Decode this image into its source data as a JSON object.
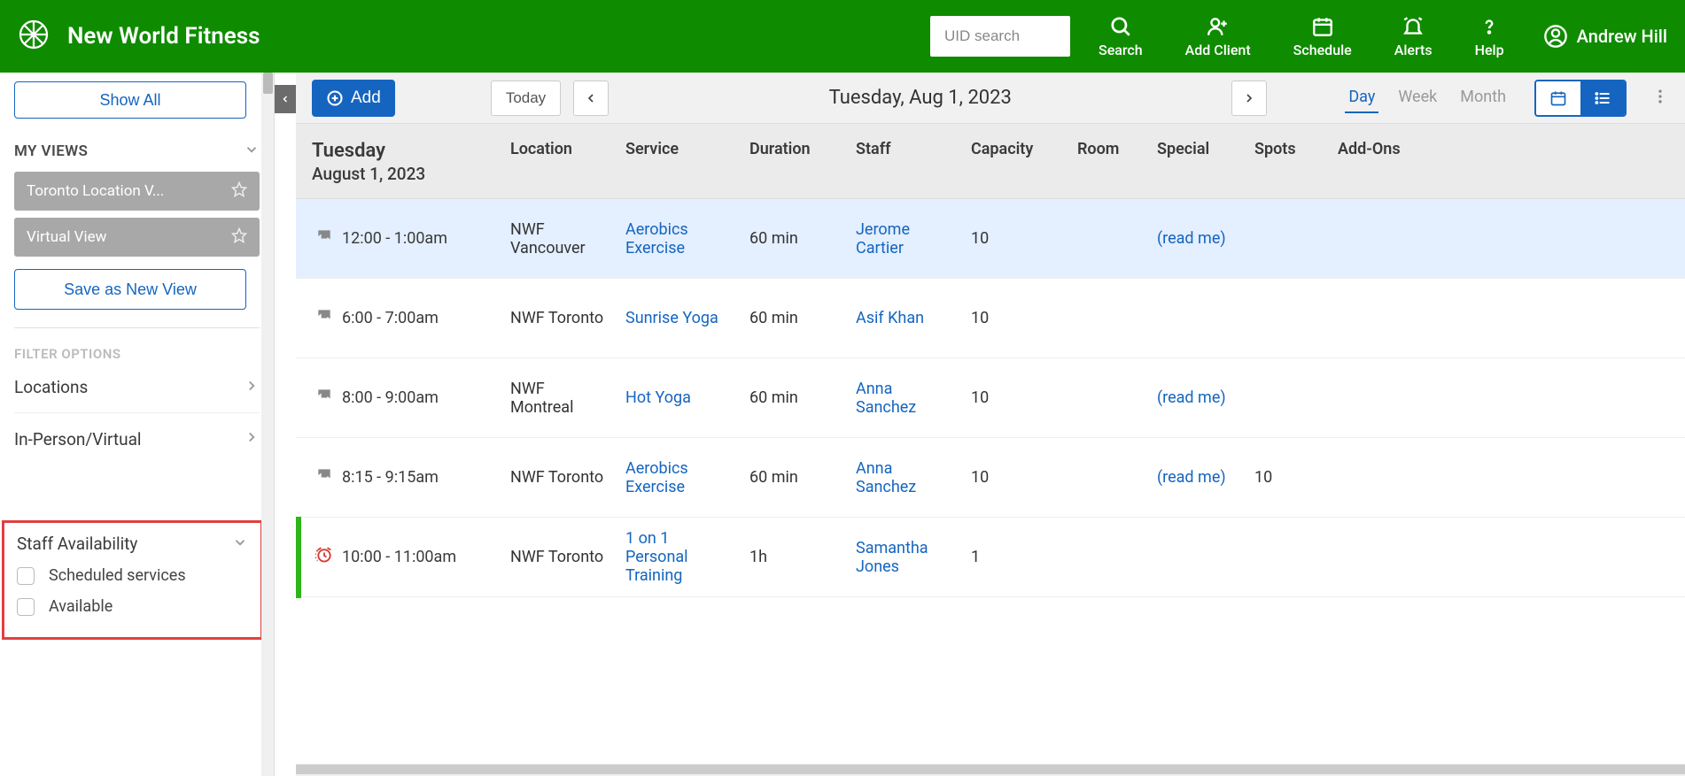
{
  "header": {
    "brand": "New World Fitness",
    "search_placeholder": "UID search",
    "nav": {
      "search": "Search",
      "add_client": "Add Client",
      "schedule": "Schedule",
      "alerts": "Alerts",
      "help": "Help"
    },
    "user": "Andrew Hill"
  },
  "sidebar": {
    "show_all": "Show All",
    "my_views_label": "MY VIEWS",
    "views": [
      {
        "label": "Toronto Location V..."
      },
      {
        "label": "Virtual View"
      }
    ],
    "save_view": "Save as New View",
    "filter_options_label": "FILTER OPTIONS",
    "filter_locations": "Locations",
    "filter_inperson": "In-Person/Virtual",
    "staff_avail": {
      "label": "Staff Availability",
      "opt_scheduled": "Scheduled services",
      "opt_available": "Available"
    }
  },
  "toolbar": {
    "add": "Add",
    "today": "Today",
    "date_display": "Tuesday, Aug 1, 2023",
    "range": {
      "day": "Day",
      "week": "Week",
      "month": "Month"
    }
  },
  "table": {
    "day_title": "Tuesday",
    "day_sub": "August 1, 2023",
    "headers": {
      "location": "Location",
      "service": "Service",
      "duration": "Duration",
      "staff": "Staff",
      "capacity": "Capacity",
      "room": "Room",
      "special": "Special",
      "spots": "Spots",
      "addons": "Add-Ons"
    },
    "rows": [
      {
        "icon": "recur",
        "highlight": true,
        "time": "12:00 - 1:00am",
        "location": "NWF Vancouver",
        "service": "Aerobics Exercise",
        "duration": "60 min",
        "staff": "Jerome Cartier",
        "capacity": "10",
        "room": "",
        "special": "(read me)",
        "spots": "",
        "addons": ""
      },
      {
        "icon": "recur",
        "time": "6:00 - 7:00am",
        "location": "NWF Toronto",
        "service": "Sunrise Yoga",
        "duration": "60 min",
        "staff": "Asif Khan",
        "capacity": "10",
        "room": "",
        "special": "",
        "spots": "",
        "addons": ""
      },
      {
        "icon": "recur",
        "time": "8:00 - 9:00am",
        "location": "NWF Montreal",
        "service": "Hot Yoga",
        "duration": "60 min",
        "staff": "Anna Sanchez",
        "capacity": "10",
        "room": "",
        "special": "(read me)",
        "spots": "",
        "addons": ""
      },
      {
        "icon": "recur",
        "time": "8:15 - 9:15am",
        "location": "NWF Toronto",
        "service": "Aerobics Exercise",
        "duration": "60 min",
        "staff": "Anna Sanchez",
        "capacity": "10",
        "room": "",
        "special": "(read me)",
        "spots": "10",
        "addons": ""
      },
      {
        "icon": "clock",
        "greenbar": true,
        "time": "10:00 - 11:00am",
        "location": "NWF Toronto",
        "service": "1 on 1 Personal Training",
        "duration": "1h",
        "staff": "Samantha Jones",
        "capacity": "1",
        "room": "",
        "special": "",
        "spots": "",
        "addons": ""
      }
    ]
  }
}
